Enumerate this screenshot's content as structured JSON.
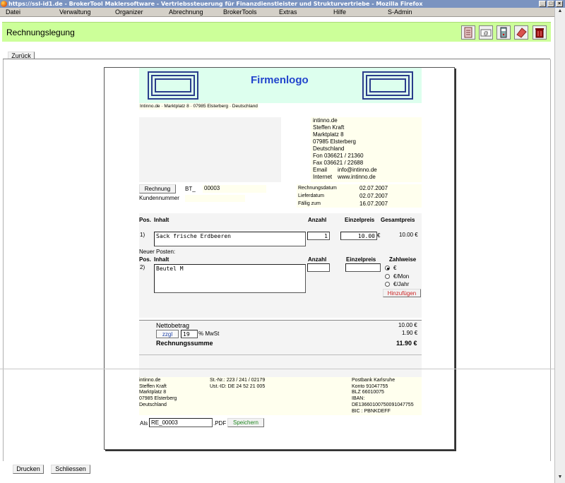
{
  "window": {
    "title": "https://ssl-id1.de - BrokerTool Maklersoftware - Vertriebssteuerung für Finanzdienstleister und Strukturvertriebe - Mozilla Firefox"
  },
  "menu": [
    "Datei",
    "Verwaltung",
    "Organizer",
    "Abrechnung",
    "BrokerTools",
    "Extras",
    "Hilfe",
    "S-Admin"
  ],
  "header": {
    "title": "Rechnungslegung",
    "toolbar_icons": [
      "document-icon",
      "email-icon",
      "server-icon",
      "eraser-icon",
      "trash-icon"
    ]
  },
  "nav": {
    "back_label": "Zurück"
  },
  "invoice": {
    "logo_text": "Firmenlogo",
    "sender_line": "Intinno.de · Marktplatz 8 · 07985 Elsterberg · Deutschland",
    "contact": {
      "lines": [
        "intinno.de",
        "Steffen Kraft",
        "Marktplatz 8",
        "07985 Elsterberg",
        "Deutschland",
        "Fon 036621 / 21360",
        "Fax 036621 / 22688"
      ],
      "email_label": "Email",
      "email_value": "info@intinno.de",
      "internet_label": "Internet",
      "internet_value": "www.intinno.de"
    },
    "doc_type_button": "Rechnung",
    "number_prefix": "BT_",
    "number": "00003",
    "customer_label": "Kundennummer",
    "dates": [
      {
        "label": "Rechnungsdatum",
        "value": "02.07.2007"
      },
      {
        "label": "Lieferdatum",
        "value": "02.07.2007"
      },
      {
        "label": "Fällig zum",
        "value": "16.07.2007"
      }
    ],
    "columns": {
      "pos": "Pos.",
      "content": "Inhalt",
      "qty": "Anzahl",
      "unit_price": "Einzelpreis",
      "total": "Gesamtpreis",
      "payment": "Zahlweise"
    },
    "items": [
      {
        "pos": "1)",
        "content": "Sack frische Erdbeeren",
        "qty": "1",
        "unit_price": "10.00",
        "currency": "€",
        "total": "10.00 €"
      }
    ],
    "new_item": {
      "label": "Neuer Posten:",
      "pos": "2)",
      "content": "Beutel M",
      "qty": "",
      "unit_price": "",
      "payment_options": [
        "€",
        "€/Mon",
        "€/Jahr"
      ],
      "selected_payment": "€",
      "add_button": "Hinzufügen"
    },
    "totals": {
      "net_label": "Nettobetrag",
      "net_value": "10.00 €",
      "vat_button": "zzgl",
      "vat_rate": "19",
      "vat_suffix": "% MwSt",
      "vat_value": "1.90 €",
      "sum_label": "Rechnungssumme",
      "sum_value": "11.90 €"
    },
    "footer": {
      "col1": [
        "intinno.de",
        "Steffen Kraft",
        "Marktplatz 8",
        "07985 Elsterberg",
        "Deutschland"
      ],
      "col2": [
        "St.-Nr.: 223 / 241 / 02179",
        "Ust.-ID: DE 24 52 21 005"
      ],
      "col3": [
        "Postbank Karlsruhe",
        "Konto 91047755",
        "BLZ 66010075",
        "IBAN:",
        "DE13660100750091047755",
        "BIC : PBNKDEFF"
      ]
    },
    "save": {
      "label": "Als",
      "filename": "RE_00003",
      "extension": ".PDF",
      "button": "Speichern"
    }
  },
  "bottom": {
    "print_label": "Drucken",
    "close_label": "Schliessen"
  }
}
